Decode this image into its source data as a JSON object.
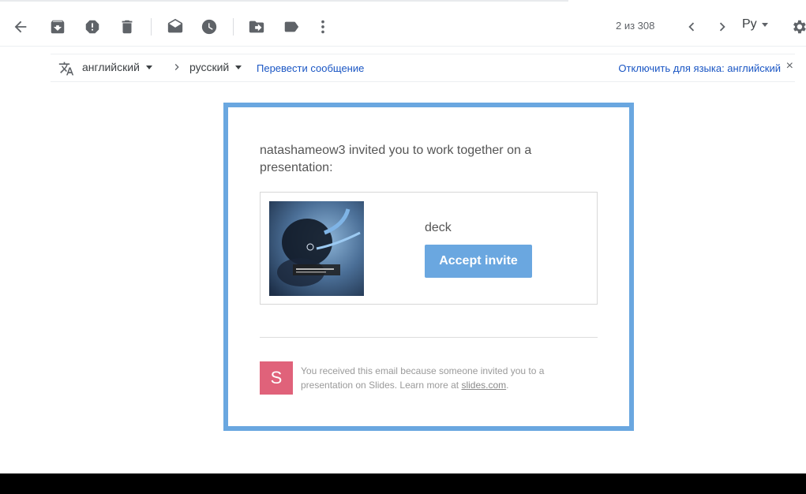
{
  "toolbar": {
    "page_count": "2 из 308",
    "language": "Ру",
    "icons": [
      "back-icon",
      "archive-icon",
      "report-spam-icon",
      "delete-icon",
      "mark-unread-icon",
      "snooze-icon",
      "move-to-icon",
      "label-icon",
      "more-icon",
      "older-icon",
      "newer-icon",
      "settings-icon"
    ]
  },
  "translation": {
    "source_lang": "английский",
    "target_lang": "русский",
    "translate_link": "Перевести сообщение",
    "disable_link": "Отключить для языка: английский",
    "close": "×"
  },
  "email": {
    "invite_text": "natashameow3 invited you to work together on a presentation:",
    "deck_name": "deck",
    "accept_label": "Accept invite",
    "logo_letter": "S",
    "footnote_text": "You received this email because someone invited you to a presentation on Slides. Learn more at ",
    "footnote_link": "slides.com",
    "footnote_end": ".",
    "accent_color": "#6aa7e0",
    "logo_color": "#e0627a"
  }
}
